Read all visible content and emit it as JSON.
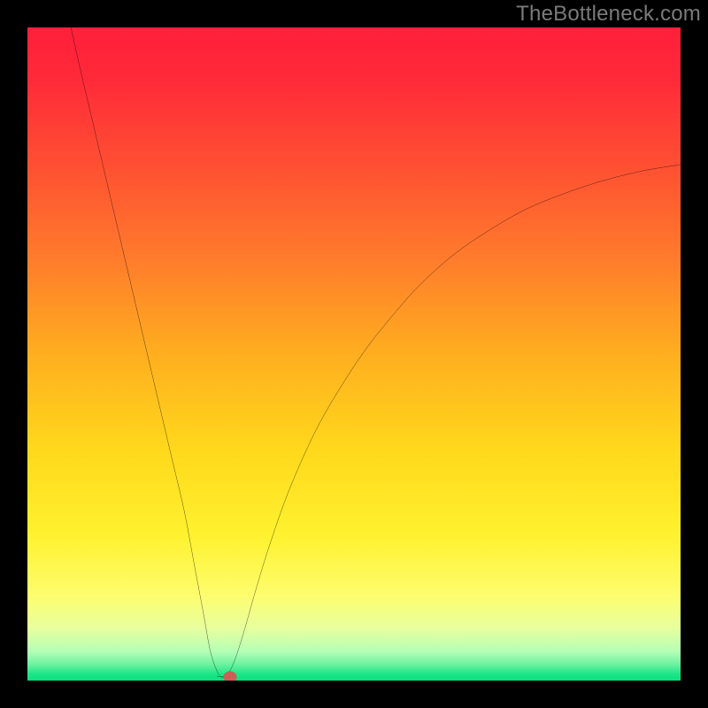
{
  "watermark": "TheBottleneck.com",
  "chart_data": {
    "type": "line",
    "title": "",
    "xlabel": "",
    "ylabel": "",
    "xlim": [
      0,
      100
    ],
    "ylim": [
      0,
      100
    ],
    "gradient_stops": [
      {
        "offset": 0.0,
        "color": "#ff1f3a"
      },
      {
        "offset": 0.08,
        "color": "#ff2a39"
      },
      {
        "offset": 0.2,
        "color": "#ff4c33"
      },
      {
        "offset": 0.35,
        "color": "#ff7a2c"
      },
      {
        "offset": 0.5,
        "color": "#ffae1f"
      },
      {
        "offset": 0.65,
        "color": "#ffd91b"
      },
      {
        "offset": 0.78,
        "color": "#fff230"
      },
      {
        "offset": 0.87,
        "color": "#fdfd6e"
      },
      {
        "offset": 0.92,
        "color": "#e7ff9e"
      },
      {
        "offset": 0.955,
        "color": "#b6ffb6"
      },
      {
        "offset": 0.975,
        "color": "#6df2a0"
      },
      {
        "offset": 0.99,
        "color": "#1de688"
      },
      {
        "offset": 1.0,
        "color": "#0ae07f"
      }
    ],
    "series": [
      {
        "name": "bottleneck-curve",
        "x": [
          6.0,
          8.0,
          10.0,
          12.0,
          14.0,
          16.0,
          18.0,
          20.0,
          22.0,
          24.0,
          25.5,
          27.0,
          28.0,
          29.0,
          29.6,
          30.3,
          31.5,
          33.0,
          35.0,
          37.0,
          40.0,
          44.0,
          48.0,
          52.0,
          56.0,
          60.0,
          65.0,
          70.0,
          76.0,
          82.0,
          88.0,
          94.0,
          100.0
        ],
        "y": [
          103.0,
          94.0,
          85.5,
          77.0,
          68.5,
          60.0,
          51.5,
          43.0,
          34.5,
          26.0,
          18.0,
          10.0,
          4.5,
          1.5,
          0.6,
          0.6,
          2.5,
          7.0,
          14.0,
          20.5,
          29.0,
          38.0,
          45.0,
          51.0,
          56.0,
          60.5,
          65.0,
          68.5,
          72.0,
          74.5,
          76.5,
          78.0,
          79.0
        ]
      }
    ],
    "flat_segment": {
      "x1": 29.0,
      "x2": 30.2,
      "y": 0.6
    },
    "marker": {
      "x": 31.0,
      "y": 0.6,
      "color": "#cc5e55"
    }
  }
}
